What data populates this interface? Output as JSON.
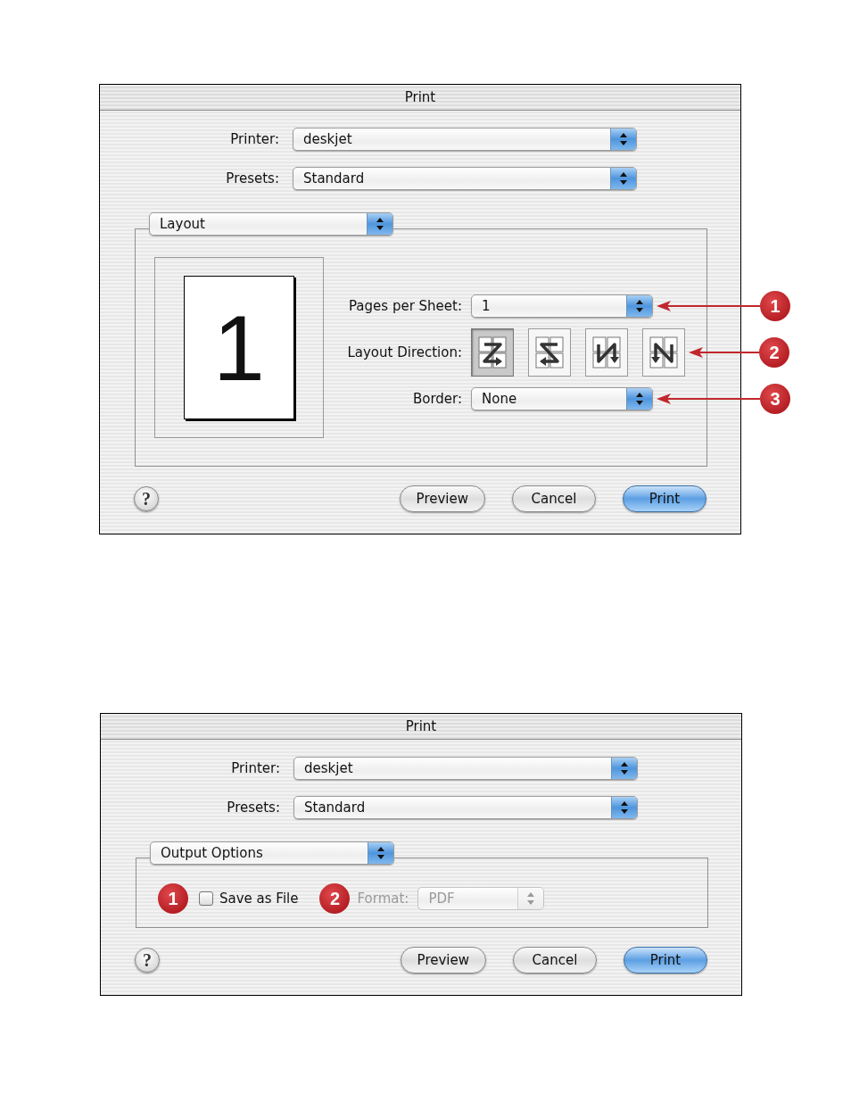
{
  "dialogs": [
    {
      "title": "Print",
      "kind": "layout",
      "top_rows": [
        {
          "label": "Printer:",
          "value": "deskjet"
        },
        {
          "label": "Presets:",
          "value": "Standard"
        }
      ],
      "panel": {
        "menu": "Layout",
        "preview_page": "1",
        "items": [
          {
            "kind": "popup",
            "label": "Pages per Sheet:",
            "value": "1",
            "disabled": false,
            "callout": "1"
          },
          {
            "kind": "direction",
            "label": "Layout Direction:",
            "options": [
              {
                "selected": true
              },
              {
                "selected": false
              },
              {
                "selected": false
              },
              {
                "selected": false
              }
            ],
            "callout": "2"
          },
          {
            "kind": "popup",
            "label": "Border:",
            "value": "None",
            "disabled": false,
            "callout": "3"
          }
        ]
      },
      "help": "?",
      "buttons": [
        {
          "label": "Preview",
          "default": false
        },
        {
          "label": "Cancel",
          "default": false
        },
        {
          "label": "Print",
          "default": true
        }
      ]
    },
    {
      "title": "Print",
      "kind": "output",
      "top_rows": [
        {
          "label": "Printer:",
          "value": "deskjet"
        },
        {
          "label": "Presets:",
          "value": "Standard"
        }
      ],
      "panel": {
        "menu": "Output Options",
        "items": [
          {
            "kind": "checkbox",
            "callout": "1",
            "label": "Save as File",
            "checked": false
          },
          {
            "kind": "popup",
            "callout": "2",
            "label": "Format:",
            "value": "PDF",
            "disabled": true
          }
        ]
      },
      "help": "?",
      "buttons": [
        {
          "label": "Preview",
          "default": false
        },
        {
          "label": "Cancel",
          "default": false
        },
        {
          "label": "Print",
          "default": true
        }
      ]
    }
  ]
}
